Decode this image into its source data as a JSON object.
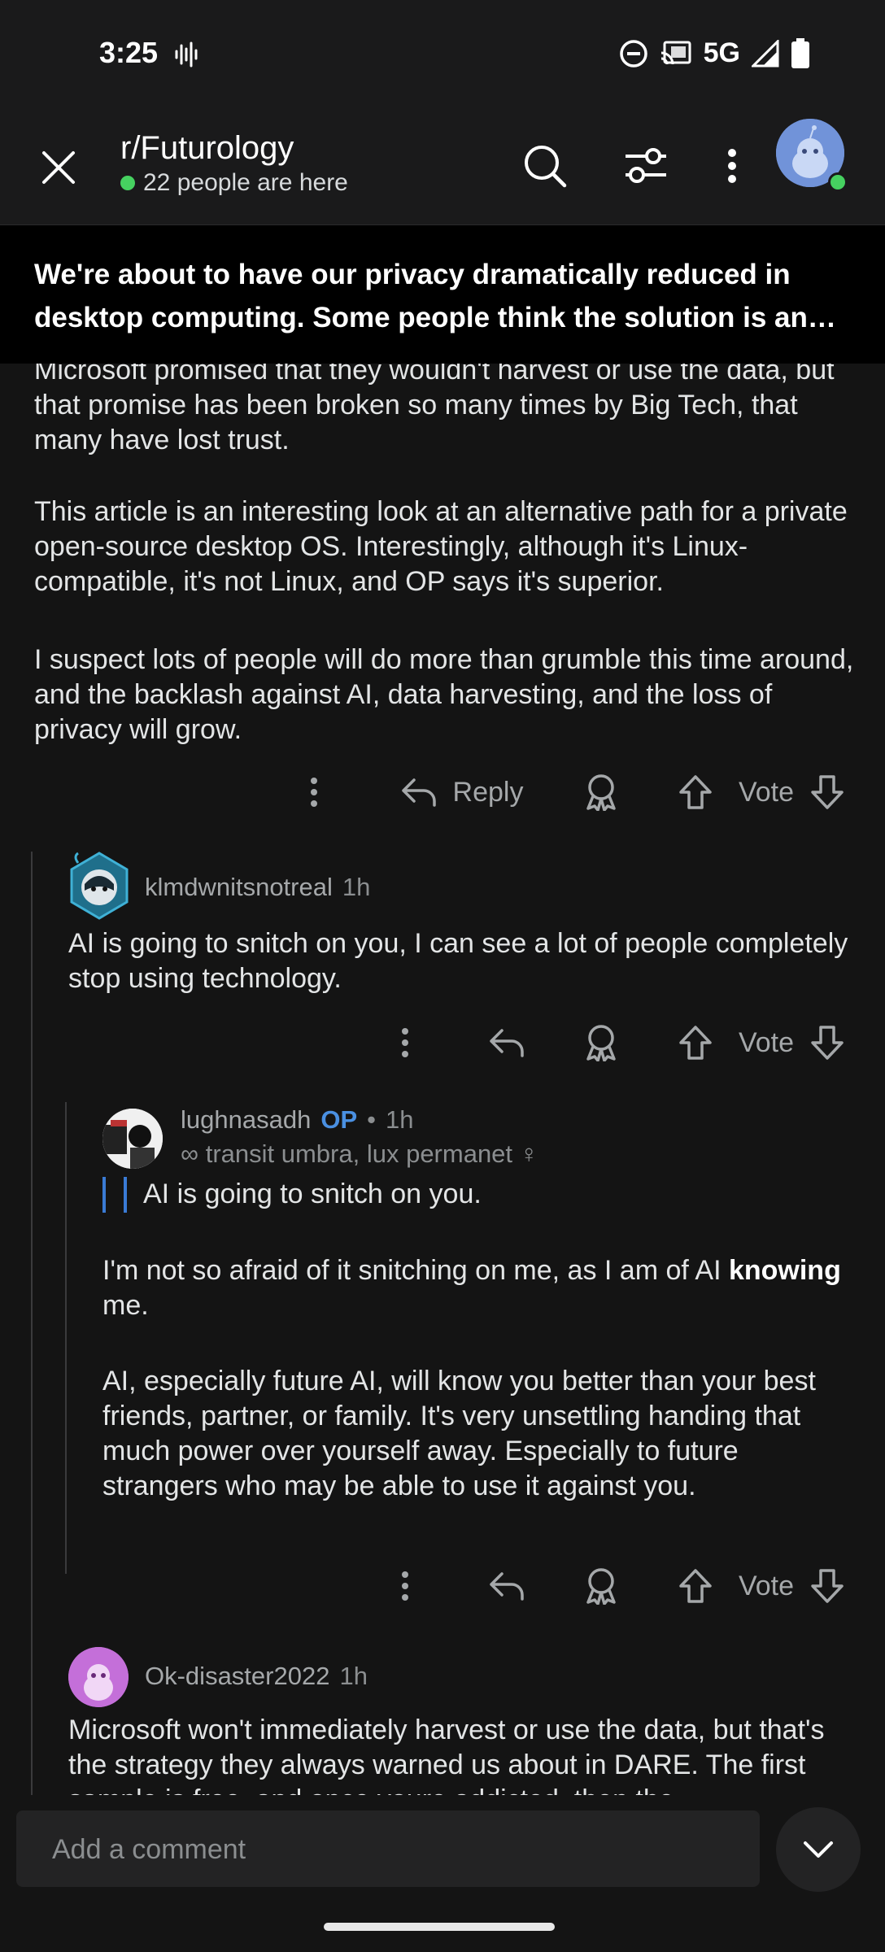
{
  "status_bar": {
    "time": "3:25",
    "network": "5G"
  },
  "header": {
    "subreddit": "r/Futurology",
    "online_count": "22 people are here"
  },
  "post": {
    "title": "We're about to have our privacy dramatically reduced in desktop computing. Some people think the solution is an open-source desktop OS.",
    "body_paragraphs": [
      "Microsoft promised that they wouldn't harvest or use the data, but that promise has been broken so many times by Big Tech, that many have lost trust.",
      "This article is an interesting look at an alternative path for a private open-source desktop OS. Interestingly, although it's Linux-compatible, it's not Linux, and OP says it's superior.",
      "I suspect lots of people will do more than grumble this time around, and the backlash against AI, data harvesting, and the loss of privacy will grow."
    ],
    "reply_label": "Reply",
    "vote_label": "Vote"
  },
  "comments": [
    {
      "username": "klmdwnitsnotreal",
      "time": "1h",
      "body": "AI is going to snitch on you, I can see a lot of people completely stop using technology.",
      "vote_label": "Vote"
    },
    {
      "username": "lughnasadh",
      "op_badge": "OP",
      "separator": "•",
      "time": "1h",
      "flair": "∞ transit umbra, lux permanet ♀",
      "quote": "AI is going to snitch on you.",
      "p1_before": "I'm not so afraid of it snitching on me, as I am of AI ",
      "p1_bold": "knowing",
      "p1_after": " me.",
      "p2": "AI, especially future AI, will know you better than your best friends, partner, or family. It's very unsettling handing that much power over yourself away. Especially to future strangers who may be able to use it against you.",
      "vote_label": "Vote"
    },
    {
      "username": "Ok-disaster2022",
      "time": "1h",
      "body": "Microsoft won't immediately harvest or use the data, but that's the strategy they always warned us about in DARE. The first sample is free, and once youre addicted, then the"
    }
  ],
  "comment_bar": {
    "placeholder": "Add a comment"
  },
  "colors": {
    "accent_blue": "#4fbcff",
    "online_green": "#46d160",
    "op_blue": "#4a90e2"
  }
}
